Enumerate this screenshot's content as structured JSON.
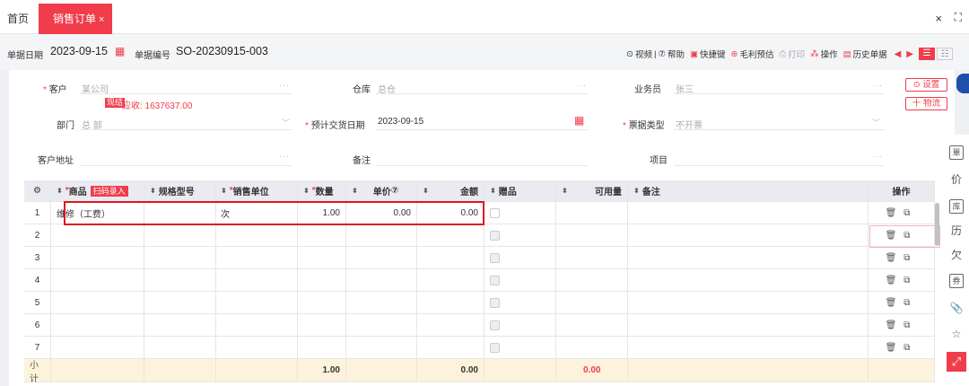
{
  "tabs": {
    "home": "首页",
    "active": "销售订单",
    "active_close": "×"
  },
  "window": {
    "close": "×",
    "fullscreen": "⛶"
  },
  "header": {
    "date_label": "单据日期",
    "date_value": "2023-09-15",
    "number_label": "单据编号",
    "number_value": "SO-20230915-003",
    "toolbar": {
      "video": "视频",
      "sep": "|",
      "help": "帮助",
      "shortcut": "快捷键",
      "profit": "毛利预估",
      "print": "打印",
      "ops": "操作",
      "history": "历史单据"
    }
  },
  "form": {
    "customer_label": "客户",
    "customer_value": "某公司",
    "cash_badge": "现结",
    "receivable": "应收: 1637637.00",
    "warehouse_label": "仓库",
    "warehouse_value": "总仓",
    "salesman_label": "业务员",
    "salesman_value": "张三",
    "dept_label": "部门",
    "dept_value": "总 部",
    "delivery_label": "预计交货日期",
    "delivery_value": "2023-09-15",
    "invoice_label": "票据类型",
    "invoice_value": "不开票",
    "address_label": "客户地址",
    "note_label": "备注",
    "project_label": "项目",
    "settings_btn": "⊙ 设置",
    "logistics_btn": "十 物流"
  },
  "grid": {
    "headers": {
      "item": "商品",
      "scan": "扫码录入",
      "spec": "规格型号",
      "unit": "销售单位",
      "qty": "数量",
      "price": "单价",
      "amount": "金额",
      "gift": "赠品",
      "available": "可用量",
      "remark": "备注",
      "ops": "操作"
    },
    "rows": [
      {
        "no": "1",
        "item": "维修（工费）",
        "unit": "次",
        "qty": "1.00",
        "price": "0.00",
        "amount": "0.00"
      },
      {
        "no": "2"
      },
      {
        "no": "3"
      },
      {
        "no": "4"
      },
      {
        "no": "5"
      },
      {
        "no": "6"
      },
      {
        "no": "7"
      }
    ],
    "subtotal": {
      "label": "小计",
      "qty": "1.00",
      "amount": "0.00",
      "available": "0.00"
    }
  },
  "sidebar": {
    "icons": [
      "單",
      "价",
      "库",
      "历",
      "欠",
      "券",
      "📎",
      "☆",
      "⤢"
    ]
  }
}
